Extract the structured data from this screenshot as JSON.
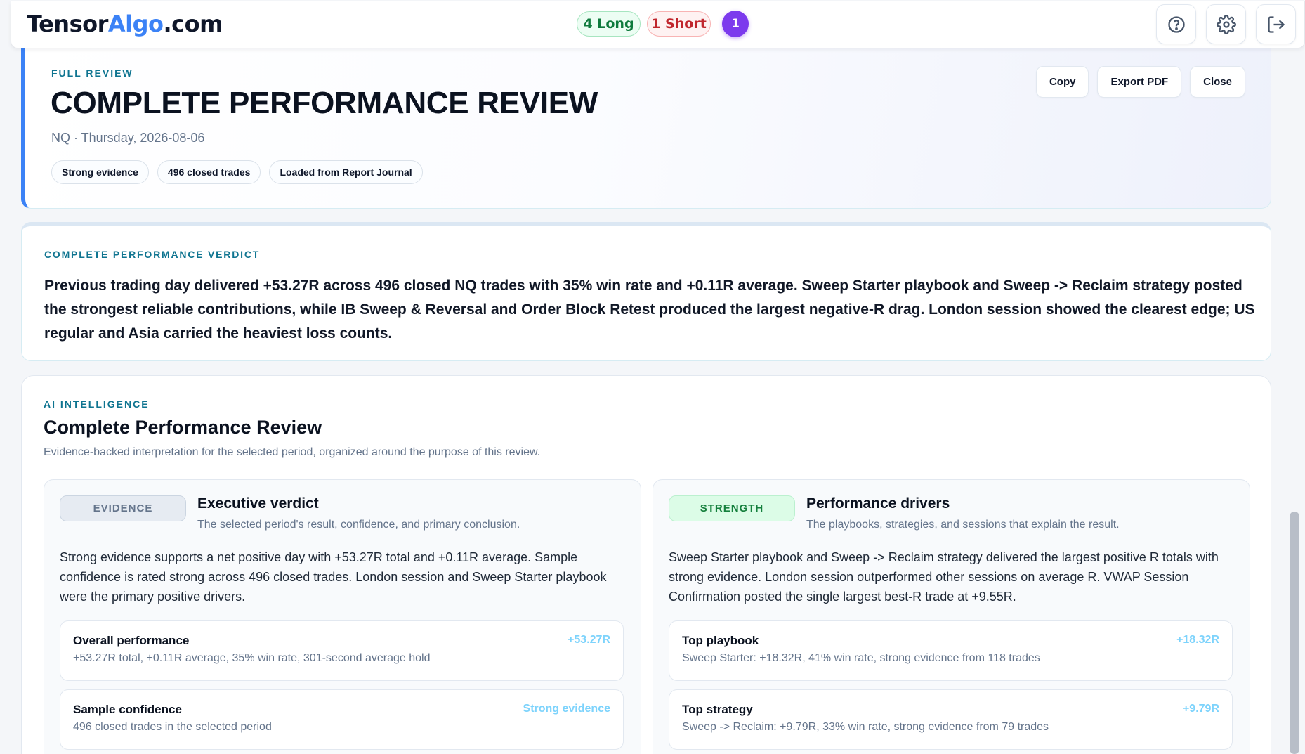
{
  "header": {
    "logo_part1": "Tensor",
    "logo_part2": "Algo",
    "logo_part3": ".com",
    "long_pill": "4 Long",
    "short_pill": "1 Short",
    "count_badge": "1",
    "icons": [
      "help-icon",
      "gear-icon",
      "logout-icon"
    ]
  },
  "hero": {
    "kicker": "FULL REVIEW",
    "title": "COMPLETE PERFORMANCE REVIEW",
    "subtitle": "NQ · Thursday, 2026-08-06",
    "tags": [
      "Strong evidence",
      "496 closed trades",
      "Loaded from Report Journal"
    ],
    "actions": {
      "copy": "Copy",
      "export": "Export PDF",
      "close": "Close"
    }
  },
  "verdict": {
    "kicker": "COMPLETE PERFORMANCE VERDICT",
    "text": "Previous trading day delivered +53.27R across 496 closed NQ trades with 35% win rate and +0.11R average. Sweep Starter playbook and Sweep -> Reclaim strategy posted the strongest reliable contributions, while IB Sweep & Reversal and Order Block Retest produced the largest negative-R drag. London session showed the clearest edge; US regular and Asia carried the heaviest loss counts."
  },
  "ai": {
    "kicker": "AI INTELLIGENCE",
    "title": "Complete Performance Review",
    "subtitle": "Evidence-backed interpretation for the selected period, organized around the purpose of this review.",
    "panels": [
      {
        "badge": "EVIDENCE",
        "title": "Executive verdict",
        "desc": "The selected period's result, confidence, and primary conclusion.",
        "body": "Strong evidence supports a net positive day with +53.27R total and +0.11R average. Sample confidence is rated strong across 496 closed trades. London session and Sweep Starter playbook were the primary positive drivers.",
        "metrics": [
          {
            "label": "Overall performance",
            "detail": "+53.27R total, +0.11R average, 35% win rate, 301-second average hold",
            "value": "+53.27R"
          },
          {
            "label": "Sample confidence",
            "detail": "496 closed trades in the selected period",
            "value": "Strong evidence"
          }
        ]
      },
      {
        "badge": "STRENGTH",
        "title": "Performance drivers",
        "desc": "The playbooks, strategies, and sessions that explain the result.",
        "body": "Sweep Starter playbook and Sweep -> Reclaim strategy delivered the largest positive R totals with strong evidence. London session outperformed other sessions on average R. VWAP Session Confirmation posted the single largest best-R trade at +9.55R.",
        "metrics": [
          {
            "label": "Top playbook",
            "detail": "Sweep Starter: +18.32R, 41% win rate, strong evidence from 118 trades",
            "value": "+18.32R"
          },
          {
            "label": "Top strategy",
            "detail": "Sweep -> Reclaim: +9.79R, 33% win rate, strong evidence from 79 trades",
            "value": "+9.79R"
          }
        ]
      }
    ]
  },
  "colors": {
    "accent_blue": "#3b82f6",
    "kicker_teal": "#0e7490",
    "long_green": "#0f7a3d",
    "short_red": "#c0262d",
    "count_purple": "#7c3aed",
    "metric_value": "#7dd3fc"
  }
}
